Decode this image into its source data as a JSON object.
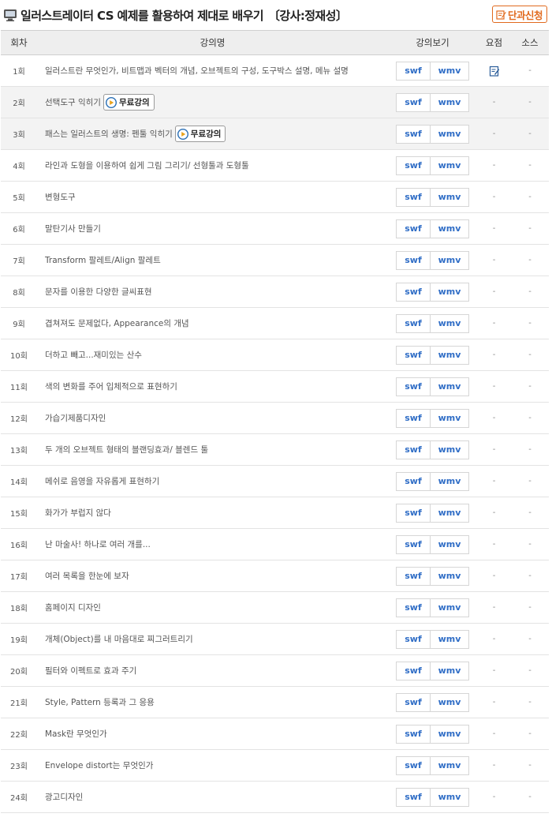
{
  "header": {
    "title": "일러스트레이터 CS 예제를 활용하여 제대로 배우기",
    "instructor": "〔강사:정재성〕",
    "apply_label": "단과신청"
  },
  "table": {
    "col_num": "회차",
    "col_name": "강의명",
    "col_view": "강의보기",
    "col_summary": "요점",
    "col_source": "소스"
  },
  "free_label": "무료강의",
  "swf_label": "swf",
  "wmv_label": "wmv",
  "dash": "-",
  "lectures": [
    {
      "num": "1회",
      "name": "일러스트란 무엇인가, 비트맵과 벡터의 개념, 오브젝트의 구성, 도구박스 설명, 메뉴 설명",
      "free": false,
      "summary": "memo",
      "source": "-"
    },
    {
      "num": "2회",
      "name": "선택도구 익히기",
      "free": true,
      "summary": "-",
      "source": "-"
    },
    {
      "num": "3회",
      "name": "패스는 일러스트의 생명: 펜툴 익히기",
      "free": true,
      "summary": "-",
      "source": "-"
    },
    {
      "num": "4회",
      "name": "라인과 도형을 이용하여 쉽게 그림 그리기/ 선형툴과 도형툴",
      "free": false,
      "summary": "-",
      "source": "-"
    },
    {
      "num": "5회",
      "name": "변형도구",
      "free": false,
      "summary": "-",
      "source": "-"
    },
    {
      "num": "6회",
      "name": "말탄기사 만들기",
      "free": false,
      "summary": "-",
      "source": "-"
    },
    {
      "num": "7회",
      "name": "Transform 팔레트/Align 팔레트",
      "free": false,
      "summary": "-",
      "source": "-"
    },
    {
      "num": "8회",
      "name": "문자를 이용한 다양한 글씨표현",
      "free": false,
      "summary": "-",
      "source": "-"
    },
    {
      "num": "9회",
      "name": "겹쳐져도 문제없다, Appearance의 개념",
      "free": false,
      "summary": "-",
      "source": "-"
    },
    {
      "num": "10회",
      "name": "더하고 빼고...재미있는 산수",
      "free": false,
      "summary": "-",
      "source": "-"
    },
    {
      "num": "11회",
      "name": "색의 변화를 주어 입체적으로 표현하기",
      "free": false,
      "summary": "-",
      "source": "-"
    },
    {
      "num": "12회",
      "name": "가습기제품디자인",
      "free": false,
      "summary": "-",
      "source": "-"
    },
    {
      "num": "13회",
      "name": "두 개의 오브젝트 형태의 블랜딩효과/ 블렌드 툴",
      "free": false,
      "summary": "-",
      "source": "-"
    },
    {
      "num": "14회",
      "name": "메쉬로 음영을 자유롭게 표현하기",
      "free": false,
      "summary": "-",
      "source": "-"
    },
    {
      "num": "15회",
      "name": "화가가 부럽지 않다",
      "free": false,
      "summary": "-",
      "source": "-"
    },
    {
      "num": "16회",
      "name": "난 마술사! 하나로 여러 개를...",
      "free": false,
      "summary": "-",
      "source": "-"
    },
    {
      "num": "17회",
      "name": "여러 목록을 한눈에 보자",
      "free": false,
      "summary": "-",
      "source": "-"
    },
    {
      "num": "18회",
      "name": "홈페이지 디자인",
      "free": false,
      "summary": "-",
      "source": "-"
    },
    {
      "num": "19회",
      "name": "개체(Object)를 내 마음대로 찌그러트리기",
      "free": false,
      "summary": "-",
      "source": "-"
    },
    {
      "num": "20회",
      "name": "필터와 이펙트로 효과 주기",
      "free": false,
      "summary": "-",
      "source": "-"
    },
    {
      "num": "21회",
      "name": "Style, Pattern 등록과 그 응용",
      "free": false,
      "summary": "-",
      "source": "-"
    },
    {
      "num": "22회",
      "name": "Mask란 무엇인가",
      "free": false,
      "summary": "-",
      "source": "-"
    },
    {
      "num": "23회",
      "name": "Envelope distort는 무엇인가",
      "free": false,
      "summary": "-",
      "source": "-"
    },
    {
      "num": "24회",
      "name": "광고디자인",
      "free": false,
      "summary": "-",
      "source": "-"
    }
  ],
  "colors": {
    "accent": "#e16a1e",
    "link": "#2f6dc6",
    "header_bg": "#eeeeee",
    "free_row_bg": "#f3f3f3"
  }
}
